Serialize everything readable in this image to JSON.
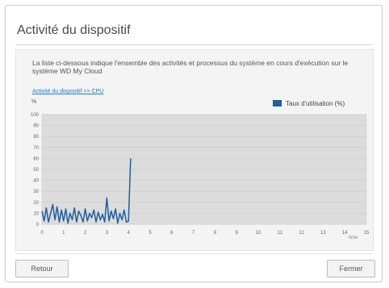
{
  "dialog": {
    "title": "Activité du dispositif",
    "description": "La liste ci-dessous indique l'ensemble des activités et processus du système en cours d'exécution sur le système WD My Cloud",
    "link": "Activité du dispositif >> CPU"
  },
  "chart_data": {
    "type": "line",
    "ylabel": "%",
    "xlabel": "time",
    "ylim": [
      0,
      100
    ],
    "xlim": [
      0,
      15
    ],
    "y_ticks": [
      "0",
      "10",
      "20",
      "30",
      "40",
      "50",
      "60",
      "70",
      "80",
      "90",
      "100"
    ],
    "x_ticks": [
      "0",
      "1",
      "2",
      "3",
      "4",
      "5",
      "6",
      "7",
      "8",
      "9",
      "10",
      "11",
      "12",
      "13",
      "14",
      "15"
    ],
    "grid": true,
    "legend_position": "top-right",
    "series": [
      {
        "name": "Taux d'utilisation (%)",
        "color": "#1f5fa0",
        "x": [
          0,
          0.1,
          0.2,
          0.3,
          0.4,
          0.5,
          0.6,
          0.7,
          0.8,
          0.9,
          1.0,
          1.1,
          1.2,
          1.3,
          1.4,
          1.5,
          1.6,
          1.7,
          1.8,
          1.9,
          2.0,
          2.1,
          2.2,
          2.3,
          2.4,
          2.5,
          2.6,
          2.7,
          2.8,
          2.9,
          3.0,
          3.1,
          3.2,
          3.3,
          3.4,
          3.5,
          3.6,
          3.7,
          3.8,
          3.9,
          4.0,
          4.1
        ],
        "values": [
          12,
          3,
          15,
          2,
          10,
          18,
          4,
          16,
          2,
          13,
          3,
          14,
          1,
          10,
          4,
          15,
          2,
          12,
          8,
          2,
          14,
          3,
          10,
          6,
          13,
          2,
          11,
          4,
          9,
          2,
          24,
          3,
          12,
          5,
          14,
          1,
          10,
          4,
          13,
          2,
          3,
          60
        ]
      }
    ]
  },
  "buttons": {
    "back": "Retour",
    "close": "Fermer"
  }
}
